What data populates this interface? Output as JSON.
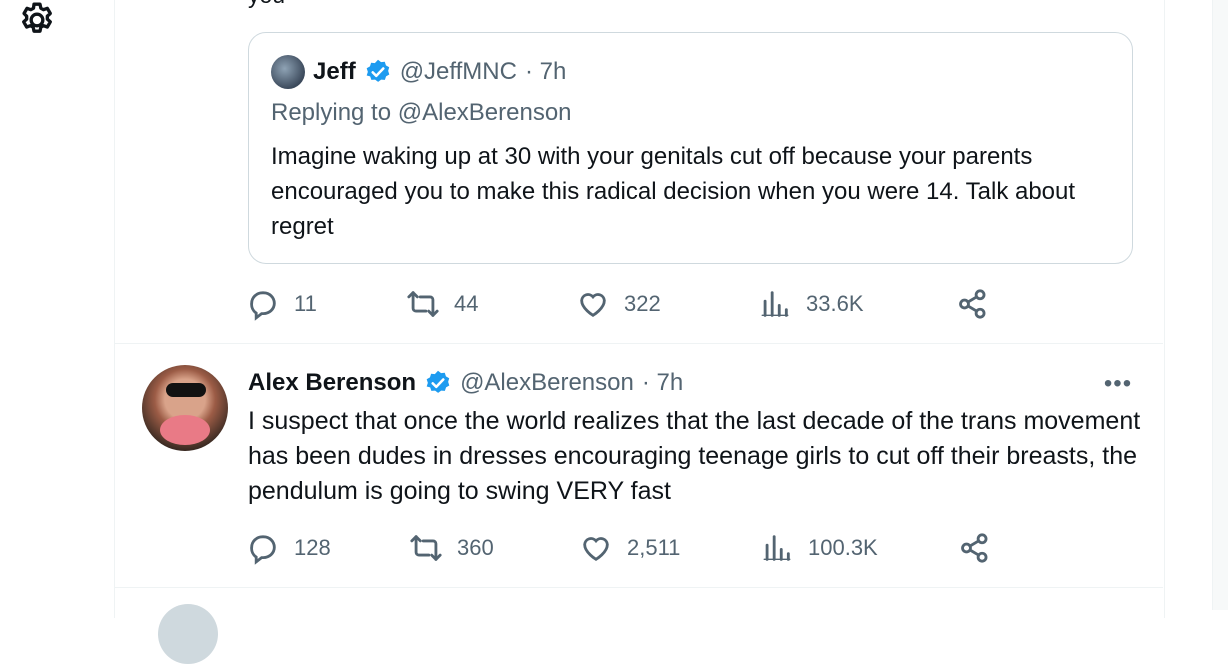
{
  "previous_tweet": {
    "tail_text": "you"
  },
  "quoted_tweet": {
    "name": "Jeff",
    "handle": "@JeffMNC",
    "time": "· 7h",
    "replying_to": "Replying to @AlexBerenson",
    "text": "Imagine waking up at 30 with your genitals cut off because your parents encouraged you to make this radical decision when you were 14. Talk about regret",
    "actions": {
      "replies": "11",
      "retweets": "44",
      "likes": "322",
      "views": "33.6K"
    }
  },
  "tweet": {
    "name": "Alex Berenson",
    "handle": "@AlexBerenson",
    "time": "· 7h",
    "more": "•••",
    "text": "I suspect that once the world realizes that the last decade of the trans movement has been dudes in dresses encouraging teenage girls to cut off their breasts, the pendulum is going to swing VERY fast",
    "actions": {
      "replies": "128",
      "retweets": "360",
      "likes": "2,511",
      "views": "100.3K"
    }
  },
  "icons": {
    "settings": "gear-icon",
    "verified": "verified-badge-icon",
    "reply": "reply-icon",
    "retweet": "retweet-icon",
    "like": "heart-icon",
    "views": "views-chart-icon",
    "share": "share-icon"
  },
  "colors": {
    "verified": "#1d9bf0",
    "muted": "#536471",
    "border": "#cfd9de"
  }
}
